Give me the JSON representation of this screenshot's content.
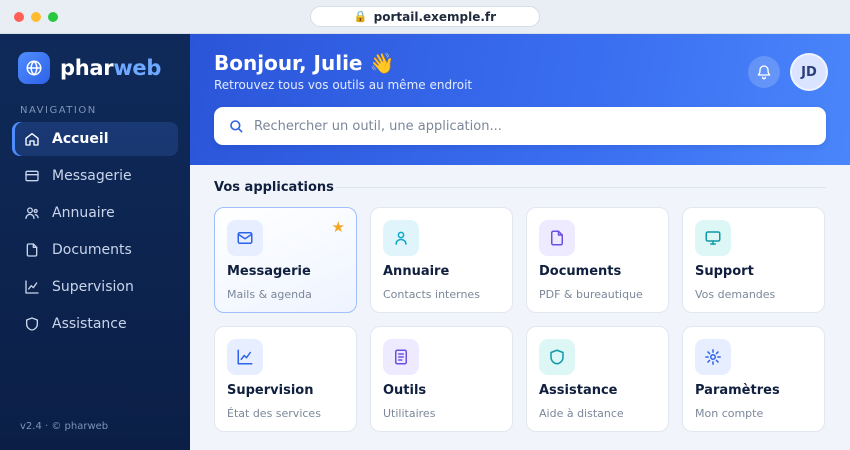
{
  "browser": {
    "url": "portail.exemple.fr"
  },
  "brand": {
    "name_part1": "phar",
    "name_part2": "web"
  },
  "sidebar": {
    "section_title": "NAVIGATION",
    "items": [
      {
        "label": "Accueil",
        "icon": "home-icon",
        "active": true
      },
      {
        "label": "Messagerie",
        "icon": "mail-icon",
        "active": false
      },
      {
        "label": "Annuaire",
        "icon": "users-icon",
        "active": false
      },
      {
        "label": "Documents",
        "icon": "document-icon",
        "active": false
      },
      {
        "label": "Supervision",
        "icon": "chart-icon",
        "active": false
      },
      {
        "label": "Assistance",
        "icon": "shield-icon",
        "active": false
      }
    ],
    "version": "v2.4 · © pharweb"
  },
  "header": {
    "greeting": "Bonjour, Julie 👋",
    "subtitle": "Retrouvez tous vos outils au même endroit",
    "avatar_initials": "JD",
    "search_placeholder": "Rechercher un outil, une application..."
  },
  "apps": {
    "title": "Vos applications",
    "items": [
      {
        "name": "Messagerie",
        "desc": "Mails & agenda",
        "icon": "mail-icon",
        "featured": true
      },
      {
        "name": "Annuaire",
        "desc": "Contacts internes",
        "icon": "user-icon",
        "featured": false
      },
      {
        "name": "Documents",
        "desc": "PDF & bureautique",
        "icon": "document-icon",
        "featured": false
      },
      {
        "name": "Support",
        "desc": "Vos demandes",
        "icon": "monitor-icon",
        "featured": false
      },
      {
        "name": "Supervision",
        "desc": "État des services",
        "icon": "chart-icon",
        "featured": false
      },
      {
        "name": "Outils",
        "desc": "Utilitaires",
        "icon": "clipboard-icon",
        "featured": false
      },
      {
        "name": "Assistance",
        "desc": "Aide à distance",
        "icon": "shield-icon",
        "featured": false
      },
      {
        "name": "Paramètres",
        "desc": "Mon compte",
        "icon": "gear-icon",
        "featured": false
      }
    ]
  },
  "colors": {
    "primary": "#2e62e8",
    "sidebar": "#0f2a5a",
    "star": "#f5a623"
  }
}
